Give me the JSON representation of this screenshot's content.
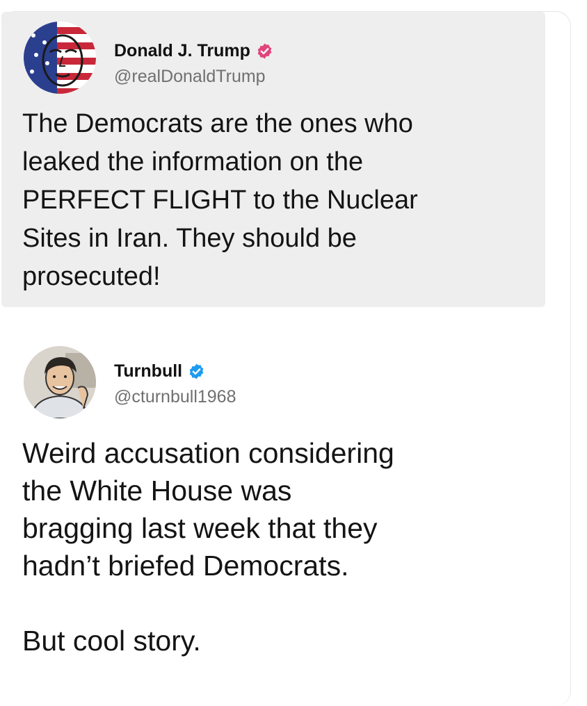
{
  "tweets": [
    {
      "name": "Donald J. Trump",
      "handle": "@realDonaldTrump",
      "badge_color": "#e0457b",
      "text": "The Democrats are the ones who\nleaked the information on the\nPERFECT FLIGHT to the Nuclear\nSites in Iran. They should be\nprosecuted!"
    },
    {
      "name": "Turnbull",
      "handle": "@cturnbull1968",
      "badge_color": "#1d9bf0",
      "text": "Weird accusation considering\nthe White House was\nbragging last week that they\nhadn’t briefed Democrats.\n\nBut cool story."
    }
  ]
}
